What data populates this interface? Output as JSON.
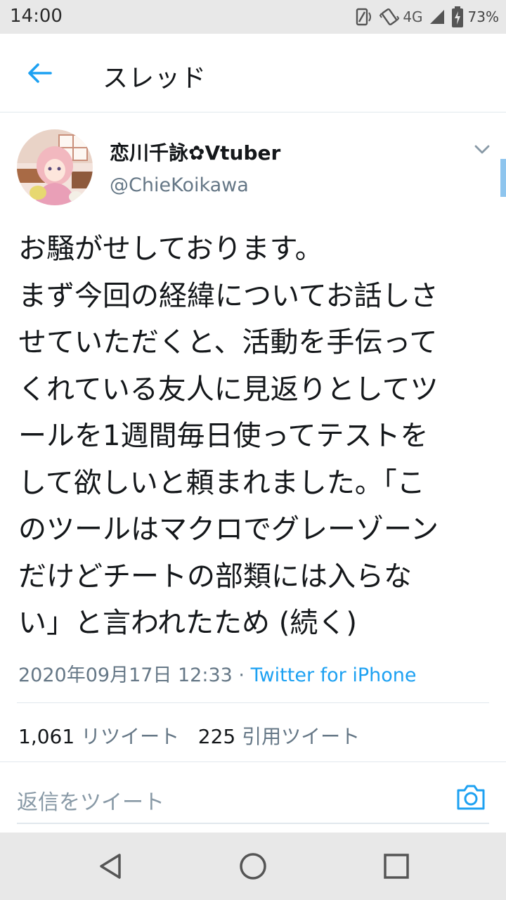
{
  "status_bar": {
    "time": "14:00",
    "network": "4G",
    "battery": "73%",
    "icons": [
      "screen-rotate-icon",
      "vibrate-icon",
      "signal-icon",
      "battery-charging-icon"
    ]
  },
  "app_bar": {
    "title": "スレッド",
    "back_icon": "arrow-left-icon"
  },
  "tweet": {
    "author_name": "恋川千詠✿Vtuber",
    "author_handle": "@ChieKoikawa",
    "lines": [
      "お騒がせしております。",
      "まず今回の経緯についてお話しさ",
      "せていただくと、活動を手伝って",
      "くれている友人に見返りとしてツ",
      "ールを1週間毎日使ってテストを",
      "して欲しいと頼まれました。「こ",
      "のツールはマクロでグレーゾーン",
      "だけどチートの部類には入らな",
      "い」と言われたため (続く)"
    ],
    "timestamp": "2020年09月17日 12:33",
    "separator": " · ",
    "source": "Twitter for iPhone",
    "retweet_count": "1,061",
    "retweet_label": "リツイート",
    "quote_count": "225",
    "quote_label": "引用ツイート"
  },
  "reply": {
    "placeholder": "返信をツイート",
    "camera_icon": "camera-icon"
  },
  "colors": {
    "accent": "#1da1f2",
    "secondary_text": "#657786",
    "divider": "#e1e8ed",
    "system_bar": "#e8e8e8"
  },
  "nav_bar": {
    "icons": [
      "nav-back-icon",
      "nav-home-icon",
      "nav-recents-icon"
    ]
  }
}
